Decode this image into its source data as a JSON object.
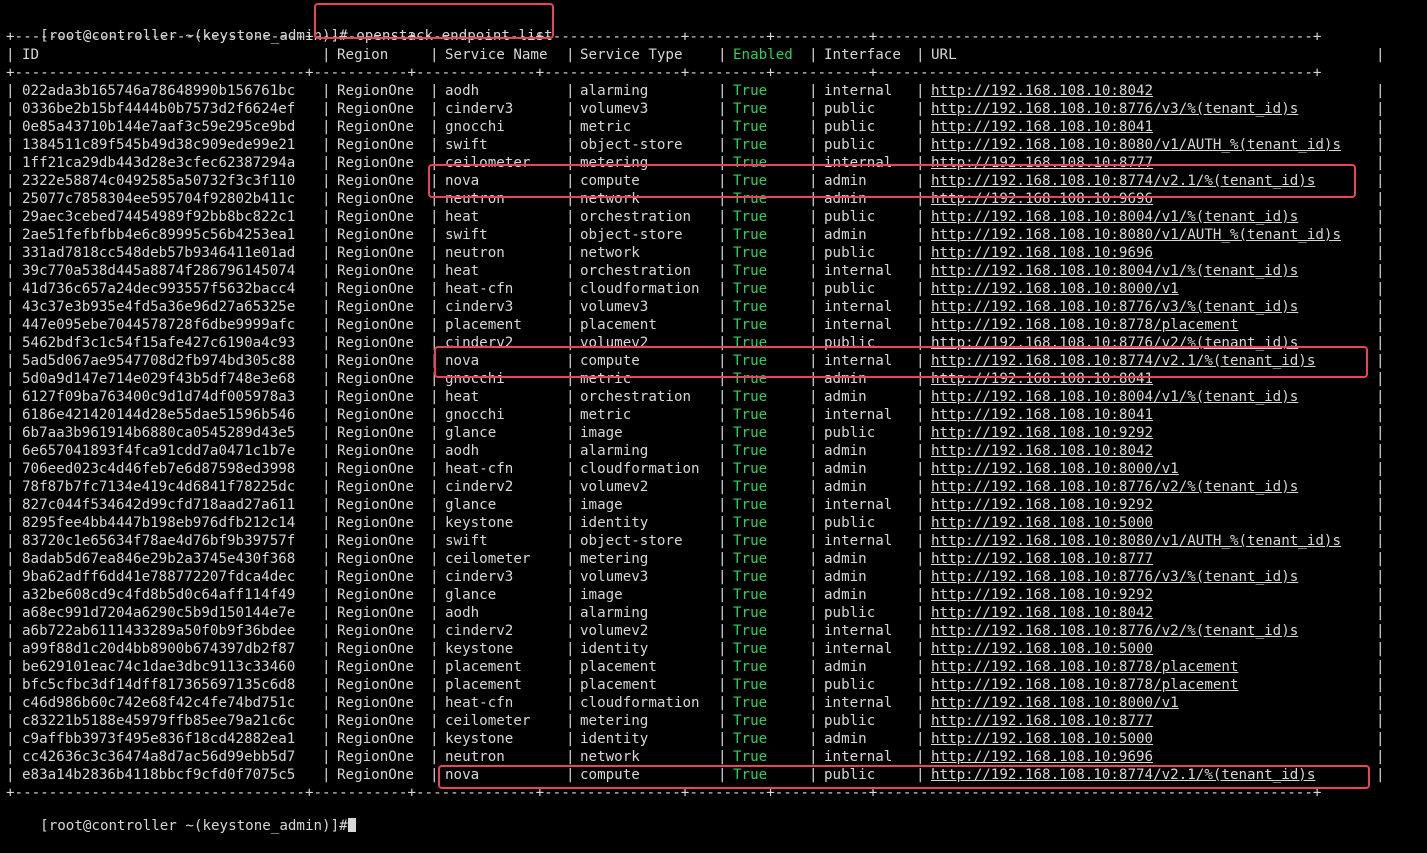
{
  "prompt": "[root@controller ~(keystone_admin)]",
  "command": "# openstack endpoint list",
  "next_prompt": "[root@controller ~(keystone_admin)]#",
  "border_line": "+----------------------------------+-----------+--------------+----------------+---------+-----------+---------------------------------------------------+",
  "headers": {
    "id": "ID",
    "region": "Region",
    "service_name": "Service Name",
    "service_type": "Service Type",
    "enabled": "Enabled",
    "interface": "Interface",
    "url": "URL"
  },
  "colors": {
    "green": "#2fd05a",
    "highlight": "#e8455a"
  },
  "rows": [
    [
      "022ada3b165746a78648990b156761bc",
      "RegionOne",
      "aodh",
      "alarming",
      "True",
      "internal",
      "http://192.168.108.10:8042"
    ],
    [
      "0336be2b15bf4444b0b7573d2f6624ef",
      "RegionOne",
      "cinderv3",
      "volumev3",
      "True",
      "public",
      "http://192.168.108.10:8776/v3/%(tenant_id)s"
    ],
    [
      "0e85a43710b144e7aaf3c59e295ce9bd",
      "RegionOne",
      "gnocchi",
      "metric",
      "True",
      "public",
      "http://192.168.108.10:8041"
    ],
    [
      "1384511c89f545b49d38c909ede99e21",
      "RegionOne",
      "swift",
      "object-store",
      "True",
      "public",
      "http://192.168.108.10:8080/v1/AUTH_%(tenant_id)s"
    ],
    [
      "1ff21ca29db443d28e3cfec62387294a",
      "RegionOne",
      "ceilometer",
      "metering",
      "True",
      "internal",
      "http://192.168.108.10:8777"
    ],
    [
      "2322e58874c0492585a50732f3c3f110",
      "RegionOne",
      "nova",
      "compute",
      "True",
      "admin",
      "http://192.168.108.10:8774/v2.1/%(tenant_id)s"
    ],
    [
      "25077c7858304ee595704f92802b411c",
      "RegionOne",
      "neutron",
      "network",
      "True",
      "admin",
      "http://192.168.108.10:9696"
    ],
    [
      "29aec3cebed74454989f92bb8bc822c1",
      "RegionOne",
      "heat",
      "orchestration",
      "True",
      "public",
      "http://192.168.108.10:8004/v1/%(tenant_id)s"
    ],
    [
      "2ae51fefbfbb4e6c89995c56b4253ea1",
      "RegionOne",
      "swift",
      "object-store",
      "True",
      "admin",
      "http://192.168.108.10:8080/v1/AUTH_%(tenant_id)s"
    ],
    [
      "331ad7818cc548deb57b9346411e01ad",
      "RegionOne",
      "neutron",
      "network",
      "True",
      "public",
      "http://192.168.108.10:9696"
    ],
    [
      "39c770a538d445a8874f286796145074",
      "RegionOne",
      "heat",
      "orchestration",
      "True",
      "internal",
      "http://192.168.108.10:8004/v1/%(tenant_id)s"
    ],
    [
      "41d736c657a24dec993557f5632bacc4",
      "RegionOne",
      "heat-cfn",
      "cloudformation",
      "True",
      "public",
      "http://192.168.108.10:8000/v1"
    ],
    [
      "43c37e3b935e4fd5a36e96d27a65325e",
      "RegionOne",
      "cinderv3",
      "volumev3",
      "True",
      "internal",
      "http://192.168.108.10:8776/v3/%(tenant_id)s"
    ],
    [
      "447e095ebe7044578728f6dbe9999afc",
      "RegionOne",
      "placement",
      "placement",
      "True",
      "internal",
      "http://192.168.108.10:8778/placement"
    ],
    [
      "5462bdf3c1c54f15afe427c6190a4c93",
      "RegionOne",
      "cinderv2",
      "volumev2",
      "True",
      "public",
      "http://192.168.108.10:8776/v2/%(tenant_id)s"
    ],
    [
      "5ad5d067ae9547708d2fb974bd305c88",
      "RegionOne",
      "nova",
      "compute",
      "True",
      "internal",
      "http://192.168.108.10:8774/v2.1/%(tenant_id)s"
    ],
    [
      "5d0a9d147e714e029f43b5df748e3e68",
      "RegionOne",
      "gnocchi",
      "metric",
      "True",
      "admin",
      "http://192.168.108.10:8041"
    ],
    [
      "6127f09ba763400c9d1d74df005978a3",
      "RegionOne",
      "heat",
      "orchestration",
      "True",
      "admin",
      "http://192.168.108.10:8004/v1/%(tenant_id)s"
    ],
    [
      "6186e421420144d28e55dae51596b546",
      "RegionOne",
      "gnocchi",
      "metric",
      "True",
      "internal",
      "http://192.168.108.10:8041"
    ],
    [
      "6b7aa3b961914b6880ca0545289d43e5",
      "RegionOne",
      "glance",
      "image",
      "True",
      "public",
      "http://192.168.108.10:9292"
    ],
    [
      "6e657041893f4fca91cdd7a0471c1b7e",
      "RegionOne",
      "aodh",
      "alarming",
      "True",
      "admin",
      "http://192.168.108.10:8042"
    ],
    [
      "706eed023c4d46feb7e6d87598ed3998",
      "RegionOne",
      "heat-cfn",
      "cloudformation",
      "True",
      "admin",
      "http://192.168.108.10:8000/v1"
    ],
    [
      "78f87b7fc7134e419c4d6841f78225dc",
      "RegionOne",
      "cinderv2",
      "volumev2",
      "True",
      "admin",
      "http://192.168.108.10:8776/v2/%(tenant_id)s"
    ],
    [
      "827c044f534642d99cfd718aad27a611",
      "RegionOne",
      "glance",
      "image",
      "True",
      "internal",
      "http://192.168.108.10:9292"
    ],
    [
      "8295fee4bb4447b198eb976dfb212c14",
      "RegionOne",
      "keystone",
      "identity",
      "True",
      "public",
      "http://192.168.108.10:5000"
    ],
    [
      "83720c1e65634f78ae4d76bf9b39757f",
      "RegionOne",
      "swift",
      "object-store",
      "True",
      "internal",
      "http://192.168.108.10:8080/v1/AUTH_%(tenant_id)s"
    ],
    [
      "8adab5d67ea846e29b2a3745e430f368",
      "RegionOne",
      "ceilometer",
      "metering",
      "True",
      "admin",
      "http://192.168.108.10:8777"
    ],
    [
      "9ba62adff6dd41e788772207fdca4dec",
      "RegionOne",
      "cinderv3",
      "volumev3",
      "True",
      "admin",
      "http://192.168.108.10:8776/v3/%(tenant_id)s"
    ],
    [
      "a32be608cd9c4fd8b5d0c64aff114f49",
      "RegionOne",
      "glance",
      "image",
      "True",
      "admin",
      "http://192.168.108.10:9292"
    ],
    [
      "a68ec991d7204a6290c5b9d150144e7e",
      "RegionOne",
      "aodh",
      "alarming",
      "True",
      "public",
      "http://192.168.108.10:8042"
    ],
    [
      "a6b722ab6111433289a50f0b9f36bdee",
      "RegionOne",
      "cinderv2",
      "volumev2",
      "True",
      "internal",
      "http://192.168.108.10:8776/v2/%(tenant_id)s"
    ],
    [
      "a99f88d1c20d4bb8900b674397db2f87",
      "RegionOne",
      "keystone",
      "identity",
      "True",
      "internal",
      "http://192.168.108.10:5000"
    ],
    [
      "be629101eac74c1dae3dbc9113c33460",
      "RegionOne",
      "placement",
      "placement",
      "True",
      "admin",
      "http://192.168.108.10:8778/placement"
    ],
    [
      "bfc5cfbc3df14dff817365697135c6d8",
      "RegionOne",
      "placement",
      "placement",
      "True",
      "public",
      "http://192.168.108.10:8778/placement"
    ],
    [
      "c46d986b60c742e68f42c4fe74bd751c",
      "RegionOne",
      "heat-cfn",
      "cloudformation",
      "True",
      "internal",
      "http://192.168.108.10:8000/v1"
    ],
    [
      "c83221b5188e45979ffb85ee79a21c6c",
      "RegionOne",
      "ceilometer",
      "metering",
      "True",
      "public",
      "http://192.168.108.10:8777"
    ],
    [
      "c9affbb3973f495e836f18cd42882ea1",
      "RegionOne",
      "keystone",
      "identity",
      "True",
      "admin",
      "http://192.168.108.10:5000"
    ],
    [
      "cc42636c3c36474a8d7ac56d99ebb5d7",
      "RegionOne",
      "neutron",
      "network",
      "True",
      "internal",
      "http://192.168.108.10:9696"
    ],
    [
      "e83a14b2836b4118bbcf9cfd0f7075c5",
      "RegionOne",
      "nova",
      "compute",
      "True",
      "public",
      "http://192.168.108.10:8774/v2.1/%(tenant_id)s"
    ]
  ]
}
